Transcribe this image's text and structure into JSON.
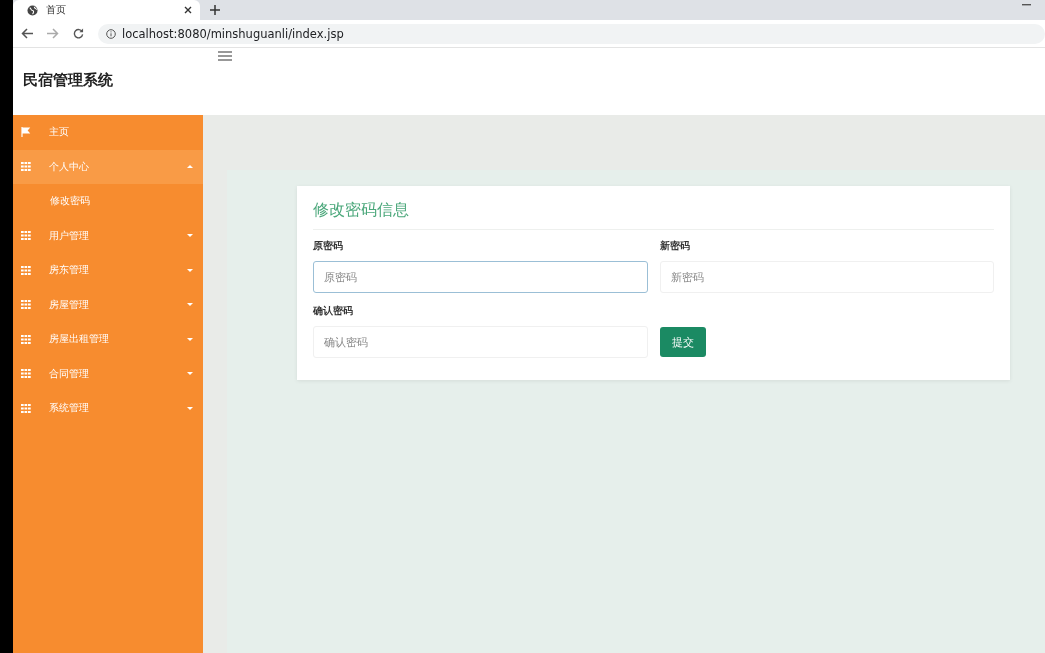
{
  "browser": {
    "tab_title": "首页",
    "url": "localhost:8080/minshuguanli/index.jsp"
  },
  "app_title": "民宿管理系统",
  "sidebar": {
    "items": [
      {
        "label": "主页",
        "kind": "link"
      },
      {
        "label": "个人中心",
        "kind": "group",
        "expanded": true,
        "children": [
          {
            "label": "修改密码"
          }
        ]
      },
      {
        "label": "用户管理",
        "kind": "group",
        "expanded": false
      },
      {
        "label": "房东管理",
        "kind": "group",
        "expanded": false
      },
      {
        "label": "房屋管理",
        "kind": "group",
        "expanded": false
      },
      {
        "label": "房屋出租管理",
        "kind": "group",
        "expanded": false
      },
      {
        "label": "合同管理",
        "kind": "group",
        "expanded": false
      },
      {
        "label": "系统管理",
        "kind": "group",
        "expanded": false
      }
    ]
  },
  "form": {
    "title": "修改密码信息",
    "fields": [
      {
        "label": "原密码",
        "placeholder": "原密码",
        "focused": true
      },
      {
        "label": "新密码",
        "placeholder": "新密码",
        "focused": false
      },
      {
        "label": "确认密码",
        "placeholder": "确认密码",
        "focused": false
      }
    ],
    "submit": "提交"
  }
}
